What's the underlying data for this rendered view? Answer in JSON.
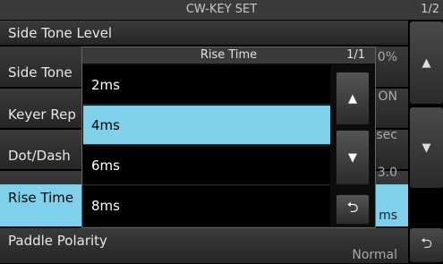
{
  "header": {
    "title": "CW-KEY SET",
    "page": "1/2"
  },
  "rows": [
    {
      "label": "Side Tone Level",
      "value": "0%"
    },
    {
      "label": "Side Tone",
      "value": "ON"
    },
    {
      "label": "Keyer Rep",
      "value": "sec"
    },
    {
      "label": "Dot/Dash",
      "value": "3.0"
    },
    {
      "label": "Rise Time",
      "value": "ms"
    },
    {
      "label": "Paddle Polarity",
      "value": "Normal"
    }
  ],
  "side": {
    "up": "▲",
    "down": "▼",
    "back": "⮌"
  },
  "dialog": {
    "title": "Rise Time",
    "page": "1/1",
    "options": [
      "2ms",
      "4ms",
      "6ms",
      "8ms"
    ],
    "selected": "4ms",
    "up": "▲",
    "down": "▼",
    "back": "⮌"
  }
}
